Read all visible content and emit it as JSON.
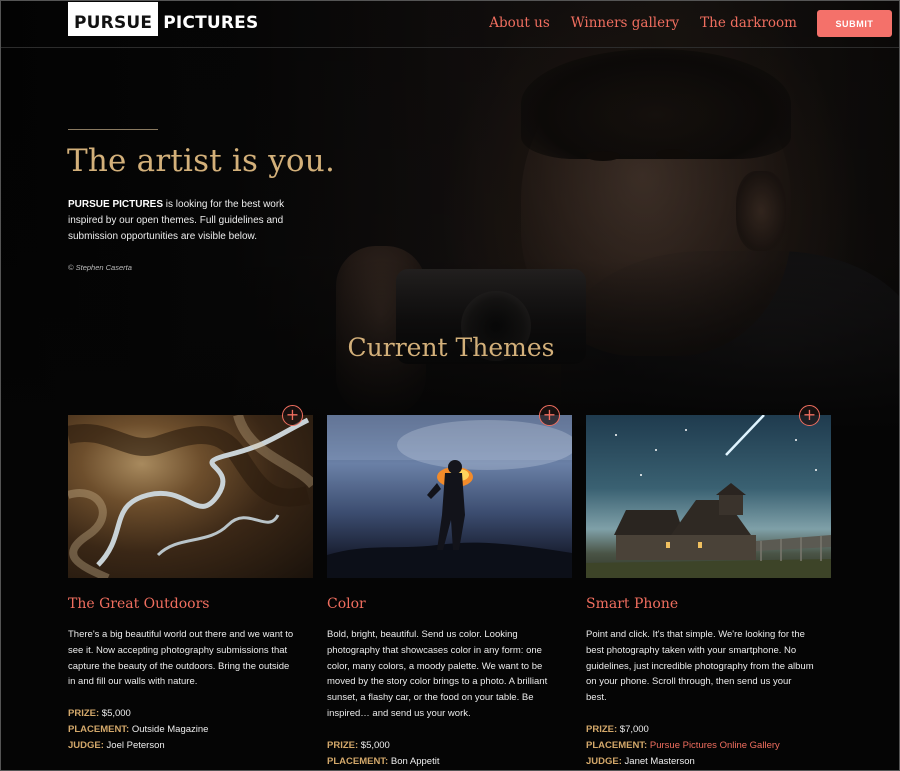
{
  "brand": {
    "part1": "PURSUE",
    "part2": "PICTURES"
  },
  "nav": {
    "links": [
      "About us",
      "Winners gallery",
      "The darkroom"
    ],
    "submit_label": "SUBMIT"
  },
  "hero": {
    "title": "The artist is you.",
    "brand_bold": "PURSUE PICTURES",
    "text": " is looking for the best work inspired by our open themes. Full guidelines and submission opportunities are visible below.",
    "credit": "© Stephen Caserta"
  },
  "themes": {
    "section_title": "Current Themes",
    "plus_icon": "+",
    "prize_label": "PRIZE:",
    "placement_label": "PLACEMENT:",
    "judge_label": "JUDGE:",
    "cards": [
      {
        "title": "The Great Outdoors",
        "description": "There's a big beautiful world out there and we want to see it. Now accepting photography submissions that capture the beauty of the outdoors. Bring the outside in and fill our walls with nature.",
        "prize": "$5,000",
        "placement": "Outside Magazine",
        "judge": "Joel Peterson"
      },
      {
        "title": "Color",
        "description": "Bold, bright, beautiful. Send us color. Looking photography that showcases color in any form: one color, many colors, a moody palette. We want to be moved by the story color brings to a photo. A brilliant sunset, a flashy car, or the food on your table. Be inspired… and send us your work.",
        "prize": "$5,000",
        "placement": "Bon Appetit"
      },
      {
        "title": "Smart Phone",
        "description": "Point and click. It's that simple. We're looking for the best photography taken with your smartphone. No guidelines, just incredible photography from the album on your phone. Scroll through, then send us your best.",
        "prize": "$7,000",
        "placement": "Pursue Pictures Online Gallery",
        "judge": "Janet Masterson"
      }
    ]
  },
  "colors": {
    "accent": "#f06e5f",
    "gold": "#d3b07a",
    "button": "#f4716a",
    "background": "#050505"
  }
}
